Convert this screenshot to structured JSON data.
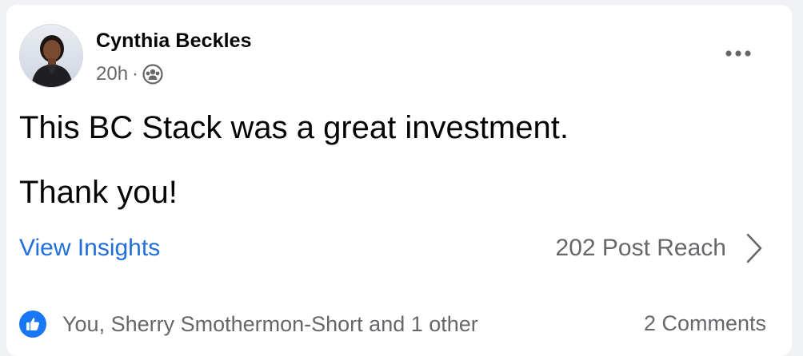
{
  "post": {
    "author_name": "Cynthia Beckles",
    "timestamp": "20h",
    "separator": "·",
    "audience_icon": "friends-audience-icon",
    "more_icon": "more-options-icon",
    "text_lines": [
      "This BC Stack was a great investment.",
      "Thank you!"
    ]
  },
  "insights": {
    "link_label": "View Insights",
    "reach_label": "202 Post Reach",
    "chevron_icon": "chevron-right-icon"
  },
  "engagement": {
    "reaction_icon": "like-icon",
    "reactions_text": "You, Sherry Smothermon-Short and 1 other",
    "comments_text": "2 Comments"
  },
  "colors": {
    "link_blue": "#216fdb",
    "like_blue": "#1877f2",
    "secondary_text": "#65676b",
    "primary_text": "#050505"
  }
}
